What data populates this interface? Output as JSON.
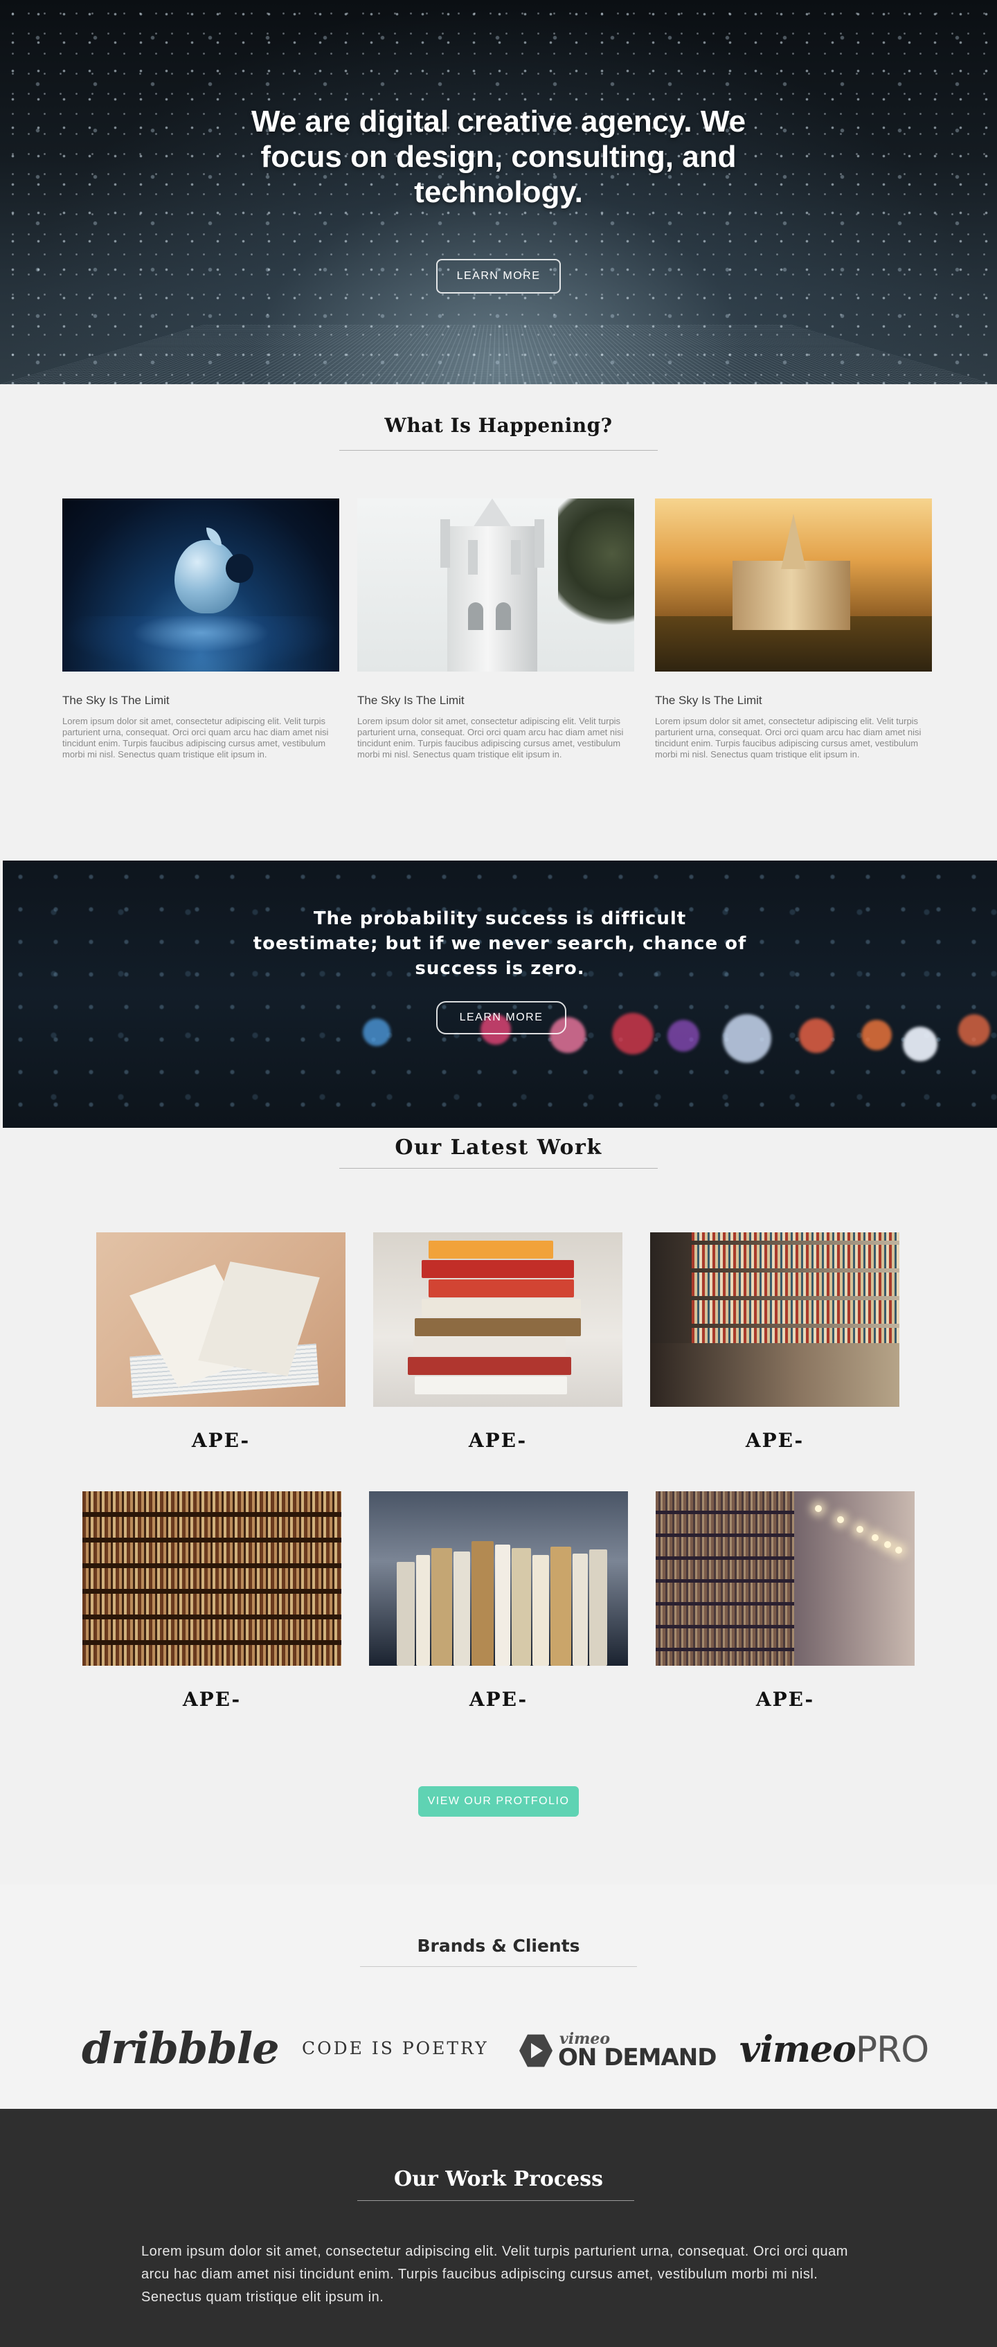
{
  "hero": {
    "headline": "We are digital creative agency. We focus on design, consulting, and technology.",
    "button_label": "LEARN MORE"
  },
  "news": {
    "title": "What Is Happening?",
    "cards": [
      {
        "title": "The Sky Is The Limit",
        "text": "Lorem ipsum dolor sit amet, consectetur adipiscing elit. Velit turpis parturient urna, consequat. Orci orci quam arcu hac diam amet nisi tincidunt enim. Turpis faucibus adipiscing cursus amet, vestibulum morbi mi nisl. Senectus quam tristique elit ipsum in."
      },
      {
        "title": "The Sky Is The Limit",
        "text": "Lorem ipsum dolor sit amet, consectetur adipiscing elit. Velit turpis parturient urna, consequat. Orci orci quam arcu hac diam amet nisi tincidunt enim. Turpis faucibus adipiscing cursus amet, vestibulum morbi mi nisl. Senectus quam tristique elit ipsum in."
      },
      {
        "title": "The Sky Is The Limit",
        "text": "Lorem ipsum dolor sit amet, consectetur adipiscing elit. Velit turpis parturient urna, consequat. Orci orci quam arcu hac diam amet nisi tincidunt enim. Turpis faucibus adipiscing cursus amet, vestibulum morbi mi nisl. Senectus quam tristique elit ipsum in."
      }
    ]
  },
  "quote": {
    "text": "The  probability success is difficult toestimate; but if we never search, chance of success is zero.",
    "button_label": "LEARN MORE"
  },
  "work": {
    "title": "Our Latest Work",
    "items": [
      {
        "label": "APE-"
      },
      {
        "label": "APE-"
      },
      {
        "label": "APE-"
      },
      {
        "label": "APE-"
      },
      {
        "label": "APE-"
      },
      {
        "label": "APE-"
      }
    ],
    "portfolio_button": "VIEW OUR PROTFOLIO"
  },
  "brands": {
    "title": "Brands & Clients",
    "logos": {
      "dribbble": "dribbble",
      "code_is_poetry": "CODE IS POETRY",
      "vimeo_on_demand_small": "vimeo",
      "vimeo_on_demand_big": "ON DEMAND",
      "vimeo_pro_bold": "vimeo",
      "vimeo_pro_light": "PRO"
    }
  },
  "process": {
    "title": "Our Work Process",
    "text": "Lorem ipsum dolor sit amet, consectetur adipiscing elit. Velit turpis parturient urna, consequat. Orci orci quam arcu hac diam amet nisi tincidunt enim. Turpis faucibus adipiscing cursus amet, vestibulum morbi mi nisl. Senectus quam tristique elit ipsum in."
  },
  "colors": {
    "accent": "#5fd3b3",
    "page_background": "#f1f1f1",
    "footer_background": "#2f2f2f"
  }
}
